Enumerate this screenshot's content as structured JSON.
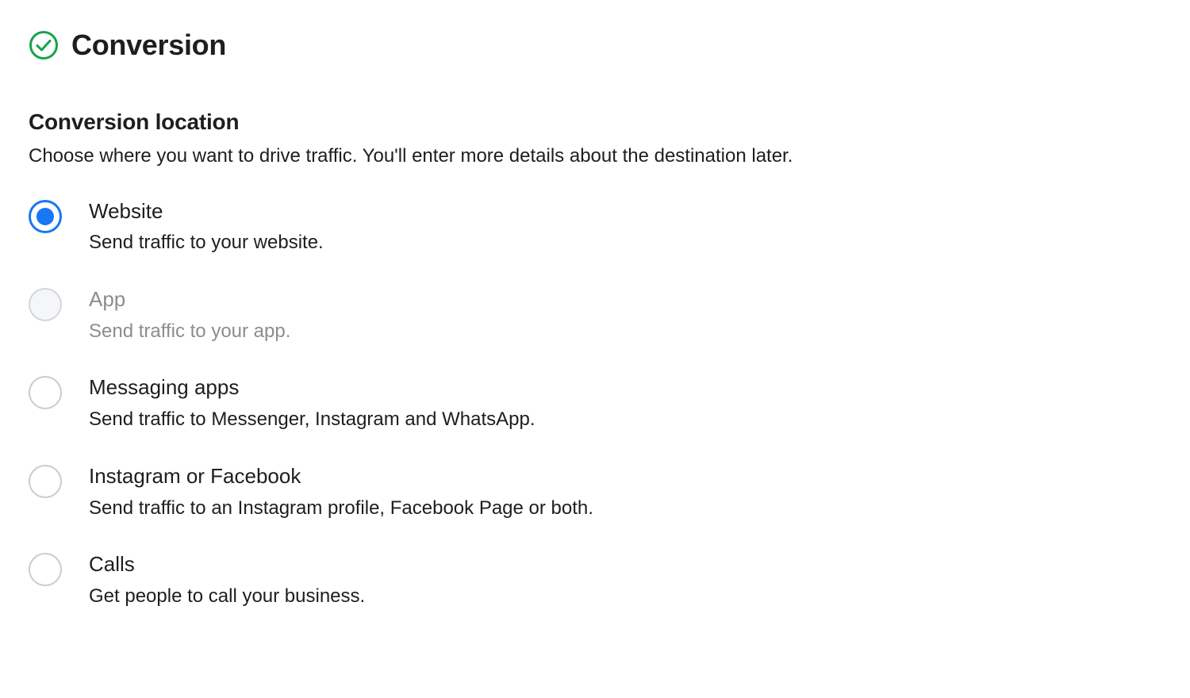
{
  "section": {
    "title": "Conversion"
  },
  "subsection": {
    "title": "Conversion location",
    "description": "Choose where you want to drive traffic. You'll enter more details about the destination later."
  },
  "options": [
    {
      "label": "Website",
      "description": "Send traffic to your website.",
      "selected": true,
      "disabled": false
    },
    {
      "label": "App",
      "description": "Send traffic to your app.",
      "selected": false,
      "disabled": true
    },
    {
      "label": "Messaging apps",
      "description": "Send traffic to Messenger, Instagram and WhatsApp.",
      "selected": false,
      "disabled": false
    },
    {
      "label": "Instagram or Facebook",
      "description": "Send traffic to an Instagram profile, Facebook Page or both.",
      "selected": false,
      "disabled": false
    },
    {
      "label": "Calls",
      "description": "Get people to call your business.",
      "selected": false,
      "disabled": false
    }
  ],
  "colors": {
    "accent": "#1877f2",
    "success": "#16a34a",
    "text": "#1c1e21",
    "muted": "#8a8d91",
    "border": "#c9ccd1"
  }
}
